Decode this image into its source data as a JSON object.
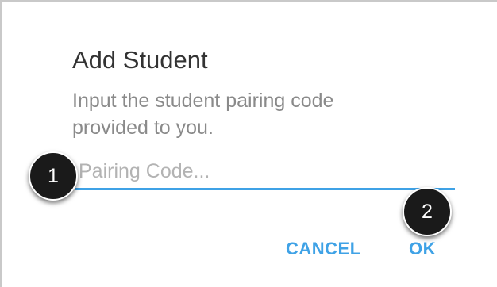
{
  "dialog": {
    "title": "Add Student",
    "message": "Input the student pairing code provided to you.",
    "input": {
      "placeholder": "Pairing Code...",
      "value": ""
    },
    "buttons": {
      "cancel_label": "CANCEL",
      "ok_label": "OK"
    }
  },
  "callouts": {
    "first": "1",
    "second": "2"
  },
  "colors": {
    "accent": "#3fa2e6",
    "title": "#333333",
    "message": "#8a8a8a",
    "placeholder": "#b3b3b3",
    "callout_bg": "#1a1a1a"
  }
}
